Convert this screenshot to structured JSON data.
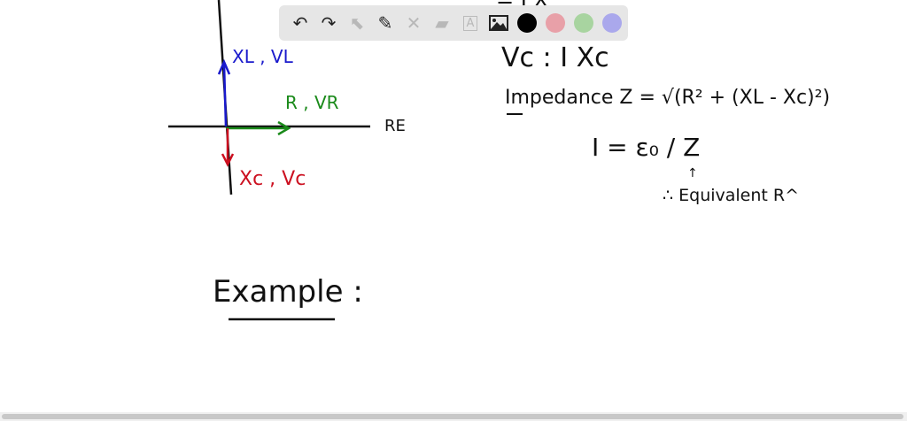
{
  "toolbar": {
    "tools": [
      {
        "name": "undo-icon",
        "glyph": "↶",
        "enabled": true
      },
      {
        "name": "redo-icon",
        "glyph": "↷",
        "enabled": true
      },
      {
        "name": "select-pointer-icon",
        "glyph": "⬉",
        "enabled": false
      },
      {
        "name": "pen-icon",
        "glyph": "✎",
        "enabled": true
      },
      {
        "name": "tools-icon",
        "glyph": "✕",
        "enabled": false
      },
      {
        "name": "eraser-icon",
        "glyph": "▰",
        "enabled": false
      },
      {
        "name": "text-icon",
        "glyph": "A",
        "enabled": false
      },
      {
        "name": "image-icon",
        "glyph": "🖼",
        "enabled": true
      }
    ],
    "colors": [
      "#000000",
      "#e8a0a8",
      "#a8d4a0",
      "#aaa8ec"
    ]
  },
  "colors": {
    "blue": "#1a1acc",
    "green": "#1a8a1a",
    "red": "#cc1020"
  },
  "board": {
    "xl_vl": "XL , VL",
    "r_vr": "R , VR",
    "re": "RE",
    "xc_vc": "Xc , Vc",
    "top_partial": "= I X",
    "vc_eq": "Vc : I Xc",
    "impedance": "Impedance  Z = √(R² + (XL - Xc)²)",
    "current": "I = ε₀ / Z",
    "arrow": "↑",
    "equiv": "∴ Equivalent R^",
    "example": "Example :"
  }
}
